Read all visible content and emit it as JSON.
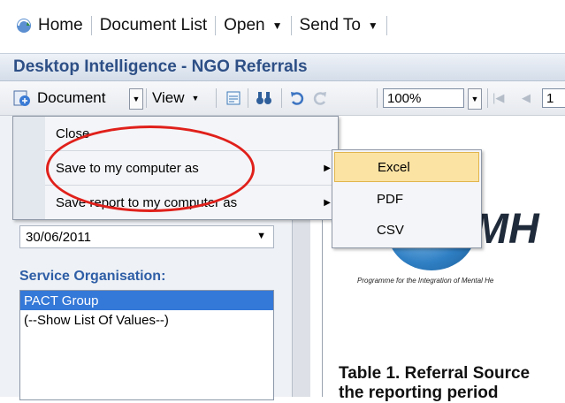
{
  "topnav": {
    "home": "Home",
    "document_list": "Document List",
    "open": "Open",
    "send_to": "Send To"
  },
  "title": "Desktop Intelligence - NGO Referrals",
  "toolbar": {
    "document": "Document",
    "view": "View",
    "zoom": "100%",
    "page": "1"
  },
  "document_menu": {
    "items": [
      {
        "label": "Close"
      },
      {
        "label": "Save to my computer as"
      },
      {
        "label": "Save report to my computer as"
      }
    ]
  },
  "save_submenu": {
    "items": [
      "Excel",
      "PDF",
      "CSV"
    ],
    "highlighted": "Excel"
  },
  "left_panel": {
    "date_value": "30/06/2011",
    "service_label": "Service Organisation:",
    "list": [
      "PACT Group",
      "(--Show List Of Values--)"
    ]
  },
  "document": {
    "logo_text": "MH",
    "tagline": "Programme for the Integration of Mental He",
    "table_title_line1": "Table 1. Referral Source",
    "table_title_line2": "the reporting period"
  },
  "colors": {
    "title_text": "#2d4f86",
    "highlight": "#fbe3a3",
    "selection": "#3478d8",
    "annotation": "#e0201b"
  }
}
